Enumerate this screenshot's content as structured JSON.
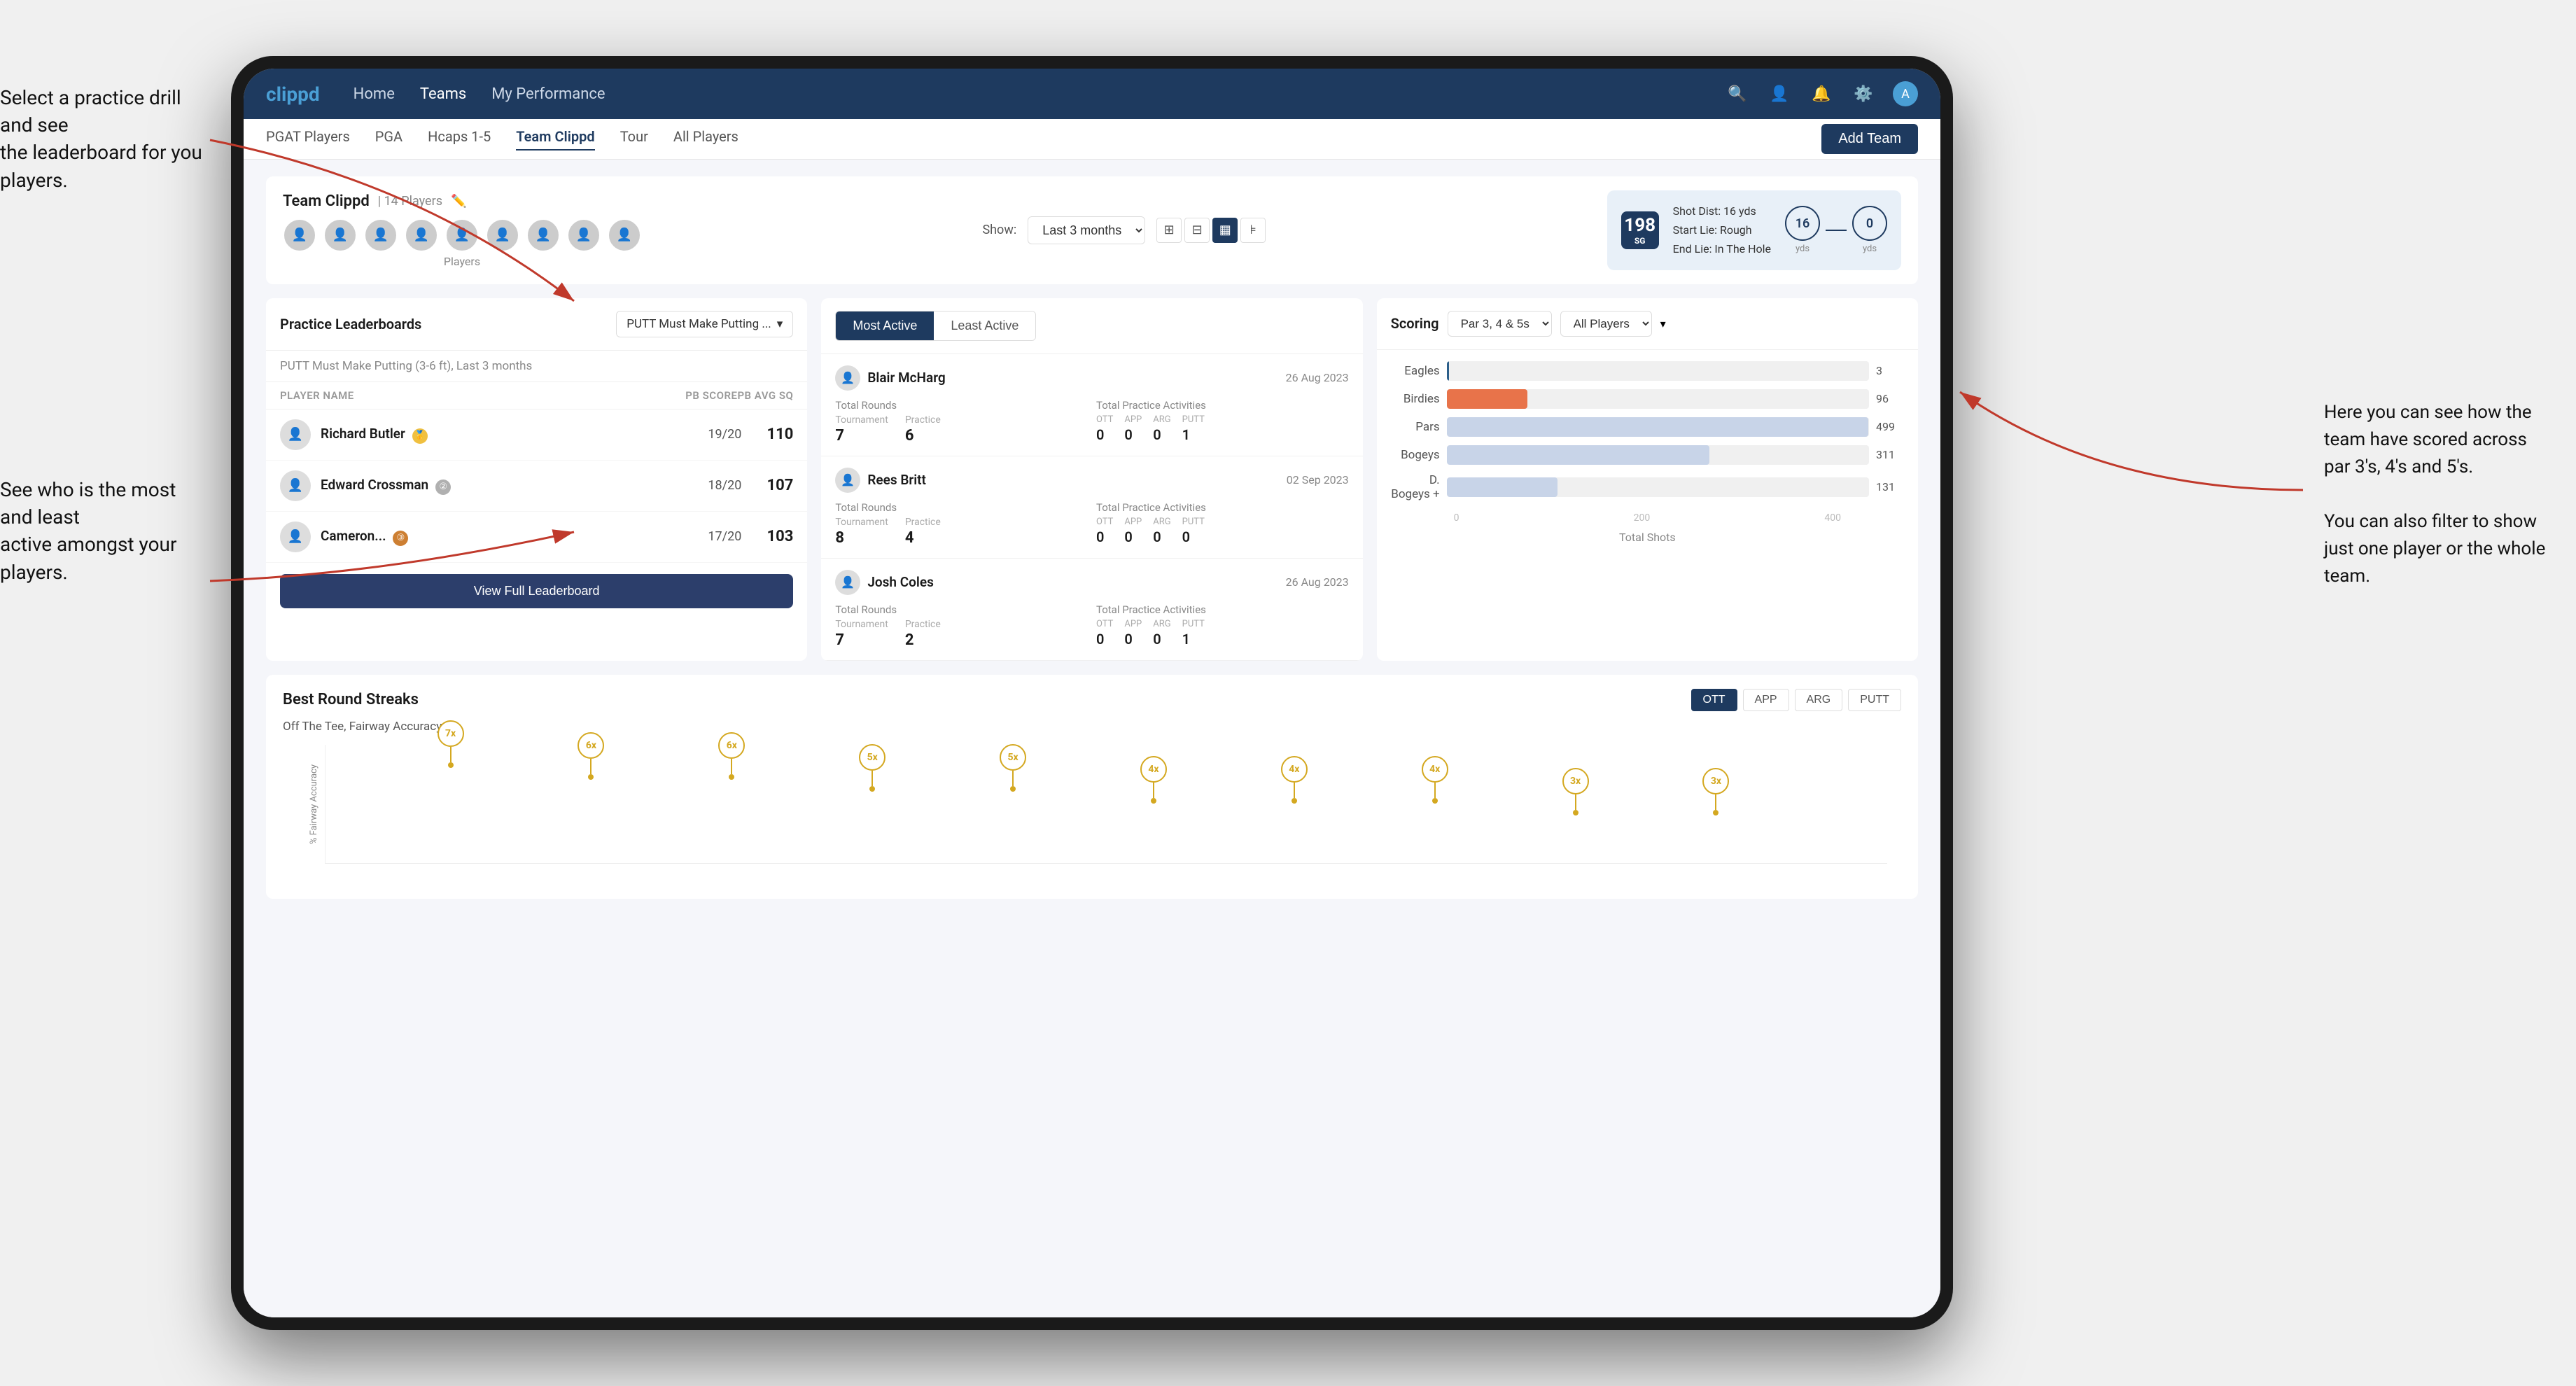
{
  "annotations": {
    "top_left": "Select a practice drill and see\nthe leaderboard for you players.",
    "bottom_left": "See who is the most and least\nactive amongst your players.",
    "right": "Here you can see how the\nteam have scored across\npar 3's, 4's and 5's.\n\nYou can also filter to show\njust one player or the whole\nteam."
  },
  "navbar": {
    "logo": "clippd",
    "links": [
      "Home",
      "Teams",
      "My Performance"
    ],
    "active_link": "Teams"
  },
  "subnav": {
    "links": [
      "PGAT Players",
      "PGA",
      "Hcaps 1-5",
      "Team Clippd",
      "Tour",
      "All Players"
    ],
    "active_link": "Team Clippd",
    "add_team_label": "Add Team"
  },
  "team_section": {
    "name": "Team Clippd",
    "count": "14 Players",
    "show_label": "Show:",
    "show_value": "Last 3 months",
    "players_label": "Players"
  },
  "shot_card": {
    "number": "198",
    "suffix": "SG",
    "shot_dist_label": "Shot Dist: 16 yds",
    "start_lie_label": "Start Lie: Rough",
    "end_lie_label": "End Lie: In The Hole",
    "circle1_val": "16",
    "circle1_label": "yds",
    "circle2_val": "0",
    "circle2_label": "yds"
  },
  "practice_leaderboards": {
    "title": "Practice Leaderboards",
    "selector": "PUTT Must Make Putting ...",
    "subtitle": "PUTT Must Make Putting (3-6 ft),",
    "subtitle_period": "Last 3 months",
    "col_player": "PLAYER NAME",
    "col_pb": "PB SCORE",
    "col_avg": "PB AVG SQ",
    "players": [
      {
        "name": "Richard Butler",
        "score": "19/20",
        "pb": "110",
        "badge": "gold",
        "badge_num": ""
      },
      {
        "name": "Edward Crossman",
        "score": "18/20",
        "pb": "107",
        "badge": "silver",
        "badge_num": "2"
      },
      {
        "name": "Cameron...",
        "score": "17/20",
        "pb": "103",
        "badge": "bronze",
        "badge_num": "3"
      }
    ],
    "view_full_label": "View Full Leaderboard"
  },
  "most_active": {
    "toggle_most": "Most Active",
    "toggle_least": "Least Active",
    "players": [
      {
        "name": "Blair McHarg",
        "date": "26 Aug 2023",
        "total_rounds_label": "Total Rounds",
        "tournament_label": "Tournament",
        "practice_label": "Practice",
        "tournament_val": "7",
        "practice_val": "6",
        "total_practice_label": "Total Practice Activities",
        "ott_label": "OTT",
        "app_label": "APP",
        "arg_label": "ARG",
        "putt_label": "PUTT",
        "ott_val": "0",
        "app_val": "0",
        "arg_val": "0",
        "putt_val": "1"
      },
      {
        "name": "Rees Britt",
        "date": "02 Sep 2023",
        "total_rounds_label": "Total Rounds",
        "tournament_label": "Tournament",
        "practice_label": "Practice",
        "tournament_val": "8",
        "practice_val": "4",
        "total_practice_label": "Total Practice Activities",
        "ott_label": "OTT",
        "app_label": "APP",
        "arg_label": "ARG",
        "putt_label": "PUTT",
        "ott_val": "0",
        "app_val": "0",
        "arg_val": "0",
        "putt_val": "0"
      },
      {
        "name": "Josh Coles",
        "date": "26 Aug 2023",
        "total_rounds_label": "Total Rounds",
        "tournament_label": "Tournament",
        "practice_label": "Practice",
        "tournament_val": "7",
        "practice_val": "2",
        "total_practice_label": "Total Practice Activities",
        "ott_label": "OTT",
        "app_label": "APP",
        "arg_label": "ARG",
        "putt_label": "PUTT",
        "ott_val": "0",
        "app_val": "0",
        "arg_val": "0",
        "putt_val": "1"
      }
    ]
  },
  "scoring": {
    "title": "Scoring",
    "filter1": "Par 3, 4 & 5s",
    "filter2": "All Players",
    "bars": [
      {
        "label": "Eagles",
        "val": 3,
        "max": 500,
        "color": "#2c5f8a"
      },
      {
        "label": "Birdies",
        "val": 96,
        "max": 500,
        "color": "#e8734a"
      },
      {
        "label": "Pars",
        "val": 499,
        "max": 500,
        "color": "#c8d4e8"
      },
      {
        "label": "Bogeys",
        "val": 311,
        "max": 500,
        "color": "#c8d4e8"
      },
      {
        "label": "D. Bogeys +",
        "val": 131,
        "max": 500,
        "color": "#c8d4e8"
      }
    ],
    "x_axis": [
      "0",
      "200",
      "400"
    ],
    "x_label": "Total Shots"
  },
  "streaks": {
    "title": "Best Round Streaks",
    "subtitle": "Off The Tee, Fairway Accuracy",
    "tabs": [
      "OTT",
      "APP",
      "ARG",
      "PUTT"
    ],
    "active_tab": "OTT",
    "y_label": "% Fairway Accuracy",
    "points": [
      {
        "x": 8,
        "y": 85,
        "label": "7x"
      },
      {
        "x": 17,
        "y": 75,
        "label": "6x"
      },
      {
        "x": 26,
        "y": 75,
        "label": "6x"
      },
      {
        "x": 35,
        "y": 65,
        "label": "5x"
      },
      {
        "x": 44,
        "y": 65,
        "label": "5x"
      },
      {
        "x": 53,
        "y": 55,
        "label": "4x"
      },
      {
        "x": 62,
        "y": 55,
        "label": "4x"
      },
      {
        "x": 71,
        "y": 55,
        "label": "4x"
      },
      {
        "x": 80,
        "y": 45,
        "label": "3x"
      },
      {
        "x": 89,
        "y": 45,
        "label": "3x"
      }
    ]
  }
}
